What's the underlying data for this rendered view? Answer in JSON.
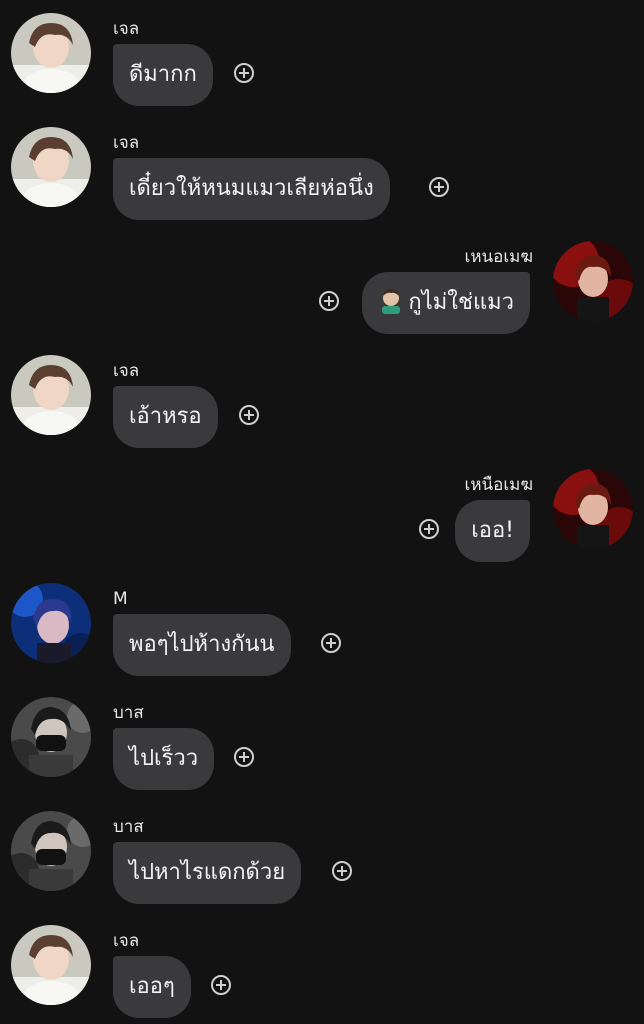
{
  "conversation": {
    "messages": [
      {
        "sender": "เจล",
        "text": "ดีมากก",
        "side": "left",
        "avatar": "jel-avatar"
      },
      {
        "sender": "เจล",
        "text": "เดี๋ยวให้หนมแมวเลียห่อนึ่ง",
        "side": "left",
        "avatar": "jel-avatar"
      },
      {
        "sender": "เหนอเมฆ",
        "text": "กูไม่ใช่แมว",
        "emoji": "facepalm-emoji",
        "side": "right",
        "avatar": "nuea-mek-avatar"
      },
      {
        "sender": "เจล",
        "text": "เอ้าหรอ",
        "side": "left",
        "avatar": "jel-avatar"
      },
      {
        "sender": "เหนือเมฆ",
        "text": "เออ!",
        "side": "right",
        "avatar": "nuea-mek-avatar"
      },
      {
        "sender": "M",
        "text": "พอๆไปห้างกันน",
        "side": "left",
        "avatar": "m-avatar"
      },
      {
        "sender": "บาส",
        "text": "ไปเร็วว",
        "side": "left",
        "avatar": "bas-avatar"
      },
      {
        "sender": "บาส",
        "text": "ไปหาไรแดกด้วย",
        "side": "left",
        "avatar": "bas-avatar"
      },
      {
        "sender": "เจล",
        "text": "เออๆ",
        "side": "left",
        "avatar": "jel-avatar"
      }
    ]
  },
  "colors": {
    "background": "#121212",
    "bubble": "#3a3a3c",
    "text": "#f4f4f4",
    "sender_text": "#e8e8e8",
    "add_reaction": "#cfcfcf"
  },
  "icons": {
    "add_reaction": "plus-circle-icon"
  }
}
